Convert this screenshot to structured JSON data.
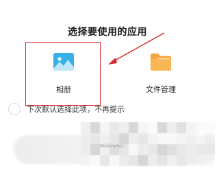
{
  "dialog": {
    "title": "选择要使用的应用"
  },
  "apps": [
    {
      "label": "相册",
      "icon": "gallery-icon",
      "highlighted": true
    },
    {
      "label": "文件管理",
      "icon": "folder-icon",
      "highlighted": false
    }
  ],
  "remember_choice": {
    "label": "下次默认选择此项，不再提示",
    "checked": false
  },
  "watermark": {
    "text": "Millimeter",
    "pixelated": true
  },
  "colors": {
    "highlight": "#d9262c",
    "gallery_icon": "#35b1e8",
    "folder_icon": "#f7a53c"
  }
}
